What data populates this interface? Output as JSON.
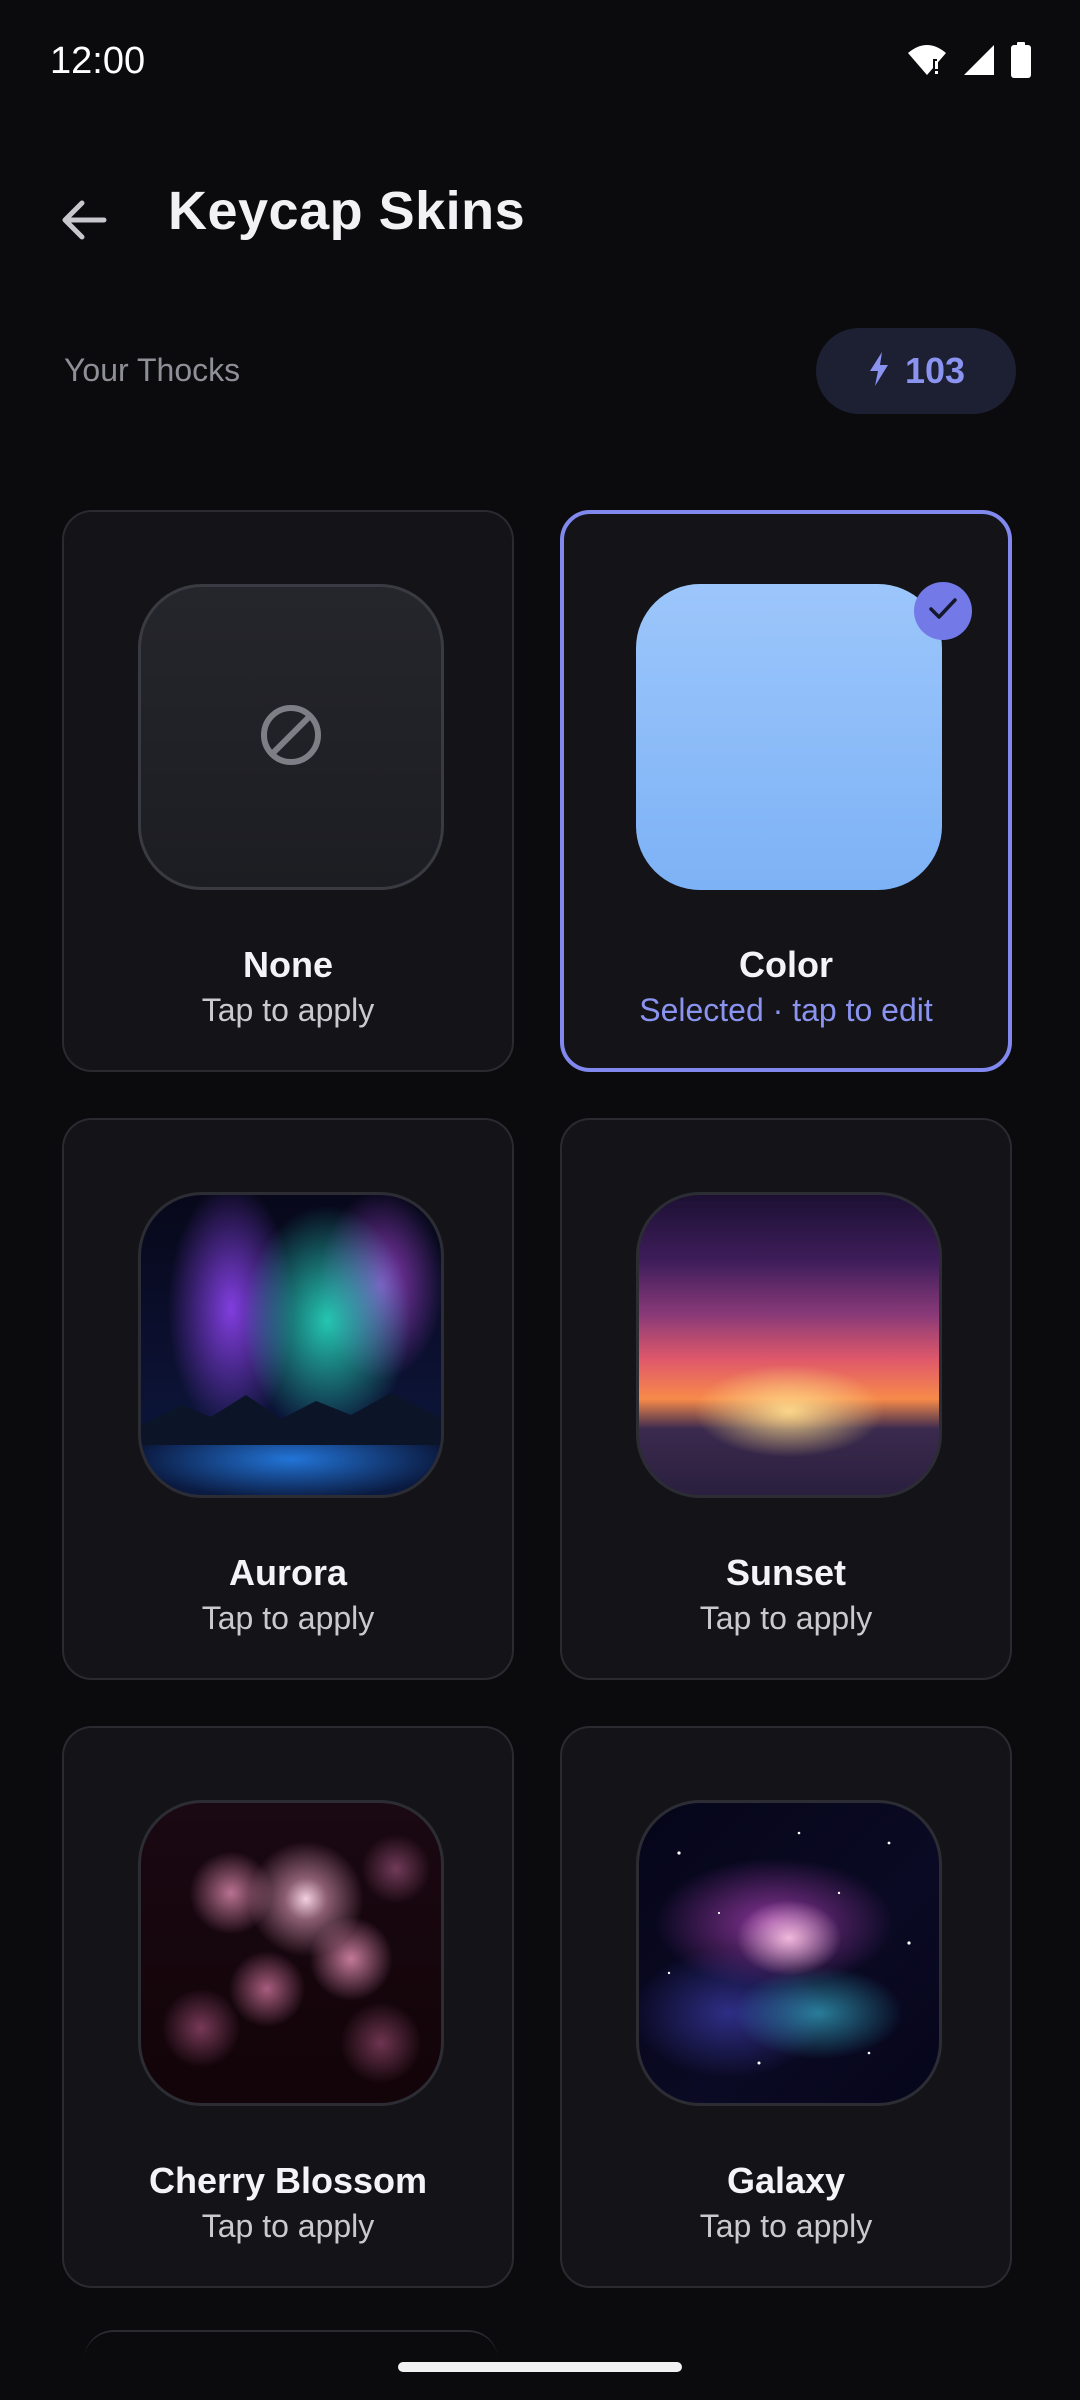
{
  "status": {
    "time": "12:00"
  },
  "header": {
    "title": "Keycap Skins"
  },
  "thocks": {
    "label": "Your Thocks",
    "value": "103"
  },
  "skins": [
    {
      "name": "None",
      "subtitle": "Tap to apply"
    },
    {
      "name": "Color",
      "subtitle": "Selected · tap to edit"
    },
    {
      "name": "Aurora",
      "subtitle": "Tap to apply"
    },
    {
      "name": "Sunset",
      "subtitle": "Tap to apply"
    },
    {
      "name": "Cherry Blossom",
      "subtitle": "Tap to apply"
    },
    {
      "name": "Galaxy",
      "subtitle": "Tap to apply"
    }
  ],
  "colors": {
    "background": "#0b0b0e",
    "card": "#141418",
    "accent": "#8189ef",
    "color_skin": "#86b6f6"
  },
  "icons": [
    "wifi-icon",
    "signal-icon",
    "battery-icon",
    "back-arrow-icon",
    "bolt-icon",
    "no-skin-icon",
    "check-icon"
  ]
}
